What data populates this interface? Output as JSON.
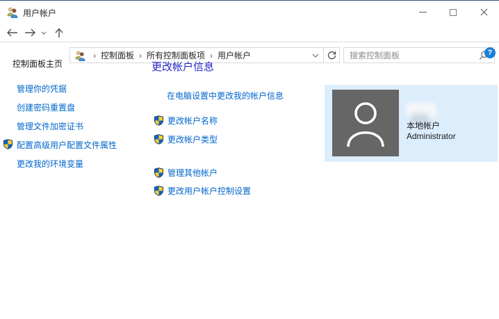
{
  "window": {
    "title": "用户帐户"
  },
  "address_bar": {
    "breadcrumb": [
      "控制面板",
      "所有控制面板项",
      "用户帐户"
    ],
    "separator": "›",
    "search_placeholder": "搜索控制面板"
  },
  "help": {
    "label": "?"
  },
  "sidebar": {
    "home": "控制面板主页",
    "links": [
      {
        "label": "管理你的凭据"
      },
      {
        "label": "创建密码重置盘"
      },
      {
        "label": "管理文件加密证书"
      },
      {
        "label": "配置高级用户配置文件属性"
      },
      {
        "label": "更改我的环境变量"
      }
    ]
  },
  "main": {
    "heading": "更改帐户信息",
    "pc_settings_link": "在电脑设置中更改我的帐户信息",
    "tasks_group1": [
      {
        "label": "更改帐户名称"
      },
      {
        "label": "更改帐户类型"
      }
    ],
    "tasks_group2": [
      {
        "label": "管理其他帐户"
      },
      {
        "label": "更改用户帐户控制设置"
      }
    ],
    "account": {
      "type_label": "本地帐户",
      "name": "Administrator"
    }
  },
  "colors": {
    "link": "#0066cc",
    "heading": "#2626c9",
    "tile_background": "#dcedfb",
    "avatar_background": "#666667",
    "help_badge": "#1d80d7"
  },
  "icons": {
    "app": "users-icon",
    "nav": [
      "back-arrow",
      "forward-arrow",
      "history-chevron",
      "up-arrow",
      "refresh"
    ],
    "search": "magnifier",
    "task_bullet": "uac-shield"
  }
}
